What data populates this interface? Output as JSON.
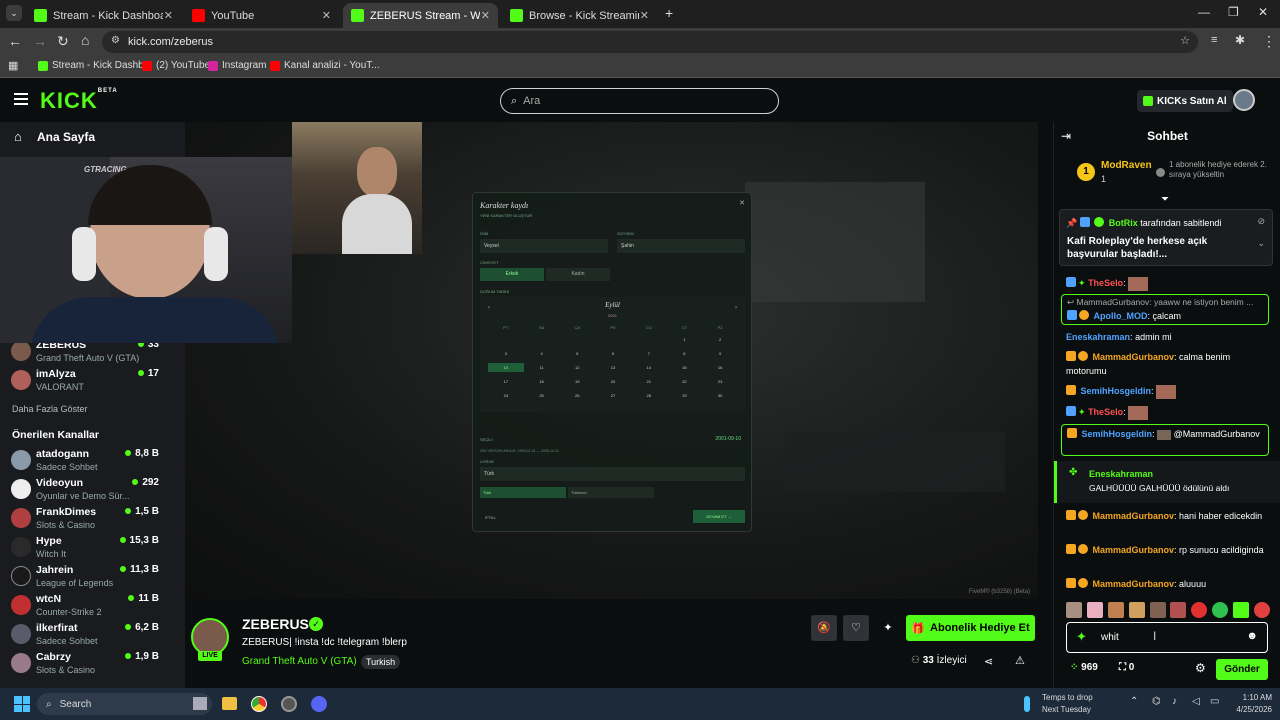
{
  "browser": {
    "tabs": [
      {
        "title": "Stream - Kick Dashboard",
        "color": "#53fc18",
        "active": false
      },
      {
        "title": "YouTube",
        "color": "#ff0000",
        "active": false
      },
      {
        "title": "ZEBERUS Stream - Watch Li",
        "color": "#53fc18",
        "active": true
      },
      {
        "title": "Browse - Kick Streaming",
        "color": "#53fc18",
        "active": false
      }
    ],
    "url": "kick.com/zeberus",
    "bookmarks": [
      "Stream - Kick Dashb...",
      "(2) YouTube",
      "Instagram",
      "Kanal analizi - YouT..."
    ]
  },
  "header": {
    "logo": "KICK",
    "logo_sup": "BETA",
    "search_placeholder": "Ara",
    "kicks_button": "KICKs Satın Al"
  },
  "sidebar": {
    "home": "Ana Sayfa",
    "following": [
      {
        "name": "ZEBERUS",
        "game": "Grand Theft Auto V (GTA)",
        "viewers": "33"
      },
      {
        "name": "imAlyza",
        "game": "VALORANT",
        "viewers": "17"
      }
    ],
    "show_more": "Daha Fazla Göster",
    "recommended_title": "Önerilen Kanallar",
    "recommended": [
      {
        "name": "atadogann",
        "game": "Sadece Sohbet",
        "viewers": "8,8 B"
      },
      {
        "name": "Videoyun",
        "game": "Oyunlar ve Demo Sür...",
        "viewers": "292"
      },
      {
        "name": "FrankDimes",
        "game": "Slots & Casino",
        "viewers": "1,5 B"
      },
      {
        "name": "Hype",
        "game": "Witch It",
        "viewers": "15,3 B"
      },
      {
        "name": "Jahrein",
        "game": "League of Legends",
        "viewers": "11,3 B"
      },
      {
        "name": "wtcN",
        "game": "Counter-Strike 2",
        "viewers": "11 B"
      },
      {
        "name": "ilkerfirat",
        "game": "Sadece Sohbet",
        "viewers": "6,2 B"
      },
      {
        "name": "Cabrzy",
        "game": "Slots & Casino",
        "viewers": "1,9 B"
      }
    ]
  },
  "video": {
    "overlay_brand": "GTRACING",
    "dialog": {
      "title": "Karakter kaydı",
      "subtitle": "YENİ KARAKTER OLUŞTUR",
      "first_name_label": "İSİM",
      "first_name": "Veysel",
      "last_name_label": "SOYİSİM",
      "last_name": "Şahin",
      "gender_label": "CİNSİYET",
      "gender_options": [
        "Erkek",
        "Kadın"
      ],
      "dob_label": "DOĞUM TARİHİ",
      "month": "Eylül",
      "year": "2001",
      "weekdays": [
        "PT",
        "SA",
        "ÇA",
        "PE",
        "CU",
        "CT",
        "PZ"
      ],
      "days": [
        "",
        "",
        "",
        "",
        "",
        "1",
        "2",
        "3",
        "4",
        "5",
        "6",
        "7",
        "8",
        "9",
        "10",
        "11",
        "12",
        "13",
        "14",
        "15",
        "16",
        "17",
        "18",
        "19",
        "20",
        "21",
        "22",
        "23",
        "24",
        "25",
        "26",
        "27",
        "28",
        "29",
        "30"
      ],
      "selected_day": "10",
      "selected_label": "SEÇİLİ",
      "selected_value": "2001-09-10",
      "range_note": "İZİN VERİLEN ARALIK: 1900-01-01 — 2008-10-31",
      "nationality_label": "UYRUK",
      "nationality_value": "Türk",
      "nationality_options": [
        "Türk",
        "Türkmen"
      ],
      "cancel": "İPTAL",
      "continue": "DEVAM ET →"
    },
    "watermark": "FiveM® (b3258) (Beta)"
  },
  "stream": {
    "name": "ZEBERUS",
    "live": "LIVE",
    "title": "ZEBERUS| !insta !dc !telegram !blerp",
    "category": "Grand Theft Auto V (GTA)",
    "tag": "Turkish",
    "subscribe_button": "Abonelik Hediye Et",
    "viewers": "33",
    "viewers_label": "İzleyici"
  },
  "chat": {
    "title": "Sohbet",
    "top_gifter": {
      "rank": "1",
      "name": "ModRaven",
      "count": "1",
      "note": "1 abonelik hediye ederek 2. sıraya yükseltin"
    },
    "pinned": {
      "by": "BotRix",
      "by_suffix": "tarafından sabitlendi",
      "text": "Kafi Roleplay'de herkese açık başvurular başladı!..."
    },
    "messages": [
      {
        "user": "TheSelo",
        "text": "",
        "color": "#ff5050"
      },
      {
        "reply": "MammadGurbanov: yaaww ne istiyon benim ...",
        "user": "Apollo_MOD",
        "text": "çalcam",
        "color": "#4fa3ff"
      },
      {
        "user": "Eneskahraman",
        "text": "admin mi",
        "color": "#4fa3ff"
      },
      {
        "user": "MammadGurbanov",
        "text": "calma benim motorumu",
        "color": "#f5a623"
      },
      {
        "user": "SemihHosgeldin",
        "text": "",
        "color": "#4fa3ff"
      },
      {
        "user": "TheSelo",
        "text": "",
        "color": "#ff5050"
      },
      {
        "user": "SemihHosgeldin",
        "text": "@MammadGurbanov",
        "color": "#4fa3ff"
      },
      {
        "user": "MammadGurbanov",
        "text": "hani haber edicekdin",
        "color": "#f5a623"
      },
      {
        "user": "MammadGurbanov",
        "text": "rp sunucu acildiginda",
        "color": "#f5a623"
      },
      {
        "user": "MammadGurbanov",
        "text": "aluuuu",
        "color": "#f5a623"
      }
    ],
    "redeem": {
      "user": "Eneskahraman",
      "text": "GALHÜÜÜÜ GALHÜÜÜ ödülünü aldı"
    },
    "input_value": "whit",
    "points": "969",
    "items": "0",
    "send_button": "Gönder"
  },
  "taskbar": {
    "search": "Search",
    "weather_line1": "Temps to drop",
    "weather_line2": "Next Tuesday",
    "time": "1:10 AM",
    "date": "4/25/2026"
  }
}
